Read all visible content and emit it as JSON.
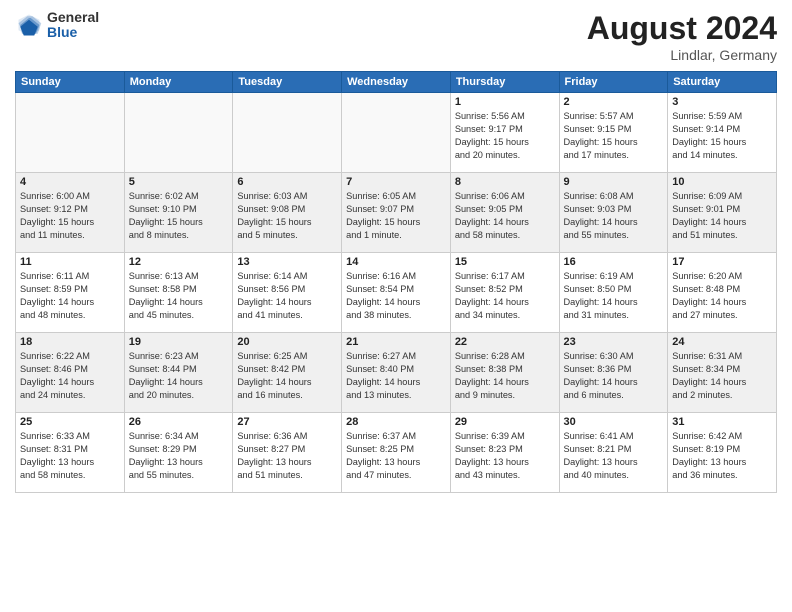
{
  "header": {
    "logo": {
      "general": "General",
      "blue": "Blue"
    },
    "title": "August 2024",
    "location": "Lindlar, Germany"
  },
  "weekdays": [
    "Sunday",
    "Monday",
    "Tuesday",
    "Wednesday",
    "Thursday",
    "Friday",
    "Saturday"
  ],
  "weeks": [
    [
      {
        "day": "",
        "info": "",
        "empty": true
      },
      {
        "day": "",
        "info": "",
        "empty": true
      },
      {
        "day": "",
        "info": "",
        "empty": true
      },
      {
        "day": "",
        "info": "",
        "empty": true
      },
      {
        "day": "1",
        "info": "Sunrise: 5:56 AM\nSunset: 9:17 PM\nDaylight: 15 hours\nand 20 minutes."
      },
      {
        "day": "2",
        "info": "Sunrise: 5:57 AM\nSunset: 9:15 PM\nDaylight: 15 hours\nand 17 minutes."
      },
      {
        "day": "3",
        "info": "Sunrise: 5:59 AM\nSunset: 9:14 PM\nDaylight: 15 hours\nand 14 minutes."
      }
    ],
    [
      {
        "day": "4",
        "info": "Sunrise: 6:00 AM\nSunset: 9:12 PM\nDaylight: 15 hours\nand 11 minutes."
      },
      {
        "day": "5",
        "info": "Sunrise: 6:02 AM\nSunset: 9:10 PM\nDaylight: 15 hours\nand 8 minutes."
      },
      {
        "day": "6",
        "info": "Sunrise: 6:03 AM\nSunset: 9:08 PM\nDaylight: 15 hours\nand 5 minutes."
      },
      {
        "day": "7",
        "info": "Sunrise: 6:05 AM\nSunset: 9:07 PM\nDaylight: 15 hours\nand 1 minute."
      },
      {
        "day": "8",
        "info": "Sunrise: 6:06 AM\nSunset: 9:05 PM\nDaylight: 14 hours\nand 58 minutes."
      },
      {
        "day": "9",
        "info": "Sunrise: 6:08 AM\nSunset: 9:03 PM\nDaylight: 14 hours\nand 55 minutes."
      },
      {
        "day": "10",
        "info": "Sunrise: 6:09 AM\nSunset: 9:01 PM\nDaylight: 14 hours\nand 51 minutes."
      }
    ],
    [
      {
        "day": "11",
        "info": "Sunrise: 6:11 AM\nSunset: 8:59 PM\nDaylight: 14 hours\nand 48 minutes."
      },
      {
        "day": "12",
        "info": "Sunrise: 6:13 AM\nSunset: 8:58 PM\nDaylight: 14 hours\nand 45 minutes."
      },
      {
        "day": "13",
        "info": "Sunrise: 6:14 AM\nSunset: 8:56 PM\nDaylight: 14 hours\nand 41 minutes."
      },
      {
        "day": "14",
        "info": "Sunrise: 6:16 AM\nSunset: 8:54 PM\nDaylight: 14 hours\nand 38 minutes."
      },
      {
        "day": "15",
        "info": "Sunrise: 6:17 AM\nSunset: 8:52 PM\nDaylight: 14 hours\nand 34 minutes."
      },
      {
        "day": "16",
        "info": "Sunrise: 6:19 AM\nSunset: 8:50 PM\nDaylight: 14 hours\nand 31 minutes."
      },
      {
        "day": "17",
        "info": "Sunrise: 6:20 AM\nSunset: 8:48 PM\nDaylight: 14 hours\nand 27 minutes."
      }
    ],
    [
      {
        "day": "18",
        "info": "Sunrise: 6:22 AM\nSunset: 8:46 PM\nDaylight: 14 hours\nand 24 minutes."
      },
      {
        "day": "19",
        "info": "Sunrise: 6:23 AM\nSunset: 8:44 PM\nDaylight: 14 hours\nand 20 minutes."
      },
      {
        "day": "20",
        "info": "Sunrise: 6:25 AM\nSunset: 8:42 PM\nDaylight: 14 hours\nand 16 minutes."
      },
      {
        "day": "21",
        "info": "Sunrise: 6:27 AM\nSunset: 8:40 PM\nDaylight: 14 hours\nand 13 minutes."
      },
      {
        "day": "22",
        "info": "Sunrise: 6:28 AM\nSunset: 8:38 PM\nDaylight: 14 hours\nand 9 minutes."
      },
      {
        "day": "23",
        "info": "Sunrise: 6:30 AM\nSunset: 8:36 PM\nDaylight: 14 hours\nand 6 minutes."
      },
      {
        "day": "24",
        "info": "Sunrise: 6:31 AM\nSunset: 8:34 PM\nDaylight: 14 hours\nand 2 minutes."
      }
    ],
    [
      {
        "day": "25",
        "info": "Sunrise: 6:33 AM\nSunset: 8:31 PM\nDaylight: 13 hours\nand 58 minutes."
      },
      {
        "day": "26",
        "info": "Sunrise: 6:34 AM\nSunset: 8:29 PM\nDaylight: 13 hours\nand 55 minutes."
      },
      {
        "day": "27",
        "info": "Sunrise: 6:36 AM\nSunset: 8:27 PM\nDaylight: 13 hours\nand 51 minutes."
      },
      {
        "day": "28",
        "info": "Sunrise: 6:37 AM\nSunset: 8:25 PM\nDaylight: 13 hours\nand 47 minutes."
      },
      {
        "day": "29",
        "info": "Sunrise: 6:39 AM\nSunset: 8:23 PM\nDaylight: 13 hours\nand 43 minutes."
      },
      {
        "day": "30",
        "info": "Sunrise: 6:41 AM\nSunset: 8:21 PM\nDaylight: 13 hours\nand 40 minutes."
      },
      {
        "day": "31",
        "info": "Sunrise: 6:42 AM\nSunset: 8:19 PM\nDaylight: 13 hours\nand 36 minutes."
      }
    ]
  ]
}
